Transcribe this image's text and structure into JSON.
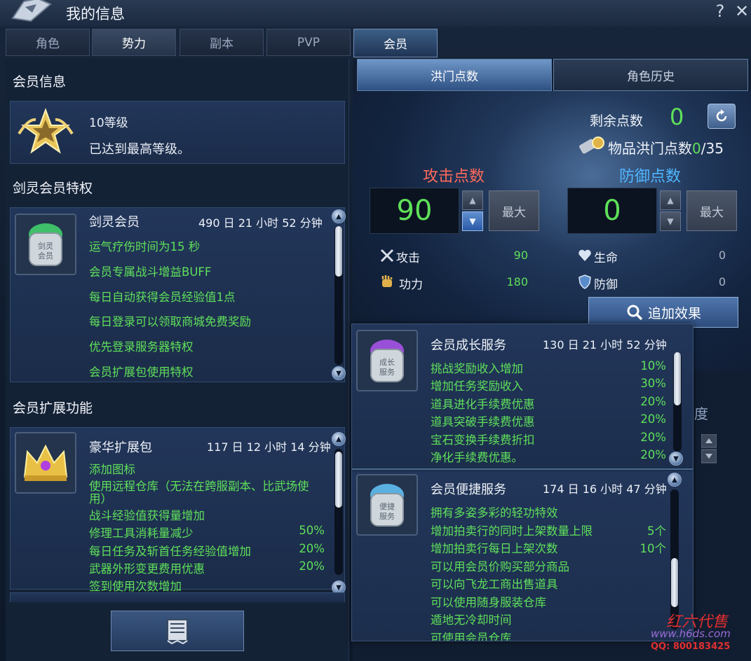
{
  "window": {
    "title": "我的信息",
    "help": "?",
    "close": "✕"
  },
  "tabs": [
    {
      "label": "角色"
    },
    {
      "label": "势力"
    },
    {
      "label": "副本"
    },
    {
      "label": "PVP"
    },
    {
      "label": "会员"
    }
  ],
  "member_info": {
    "heading": "会员信息",
    "grade": "10等级",
    "status": "已达到最高等级。"
  },
  "privileges": {
    "heading": "剑灵会员特权",
    "card": {
      "title": "剑灵会员",
      "time": "490 日 21 小时 52 分钟",
      "lines": [
        "运气疗伤时间为15 秒",
        "会员专属战斗增益BUFF",
        "每日自动获得会员经验值1点",
        "每日登录可以领取商城免费奖励",
        "优先登录服务器特权",
        "会员扩展包使用特权"
      ]
    }
  },
  "extensions": {
    "heading": "会员扩展功能",
    "card": {
      "title": "豪华扩展包",
      "time": "117 日 12 小时 14 分钟",
      "lines": [
        {
          "text": "添加图标",
          "pct": ""
        },
        {
          "text": "使用远程仓库（无法在跨服副本、比武场使",
          "pct": ""
        },
        {
          "text": "用）",
          "pct": ""
        },
        {
          "text": "战斗经验值获得量增加",
          "pct": ""
        },
        {
          "text": "修理工具消耗量减少",
          "pct": "50%"
        },
        {
          "text": "每日任务及斩首任务经验值增加",
          "pct": "20%"
        },
        {
          "text": "武器外形变更费用优惠",
          "pct": "20%"
        },
        {
          "text": "签到使用次数增加",
          "pct": ""
        }
      ]
    }
  },
  "hongmen": {
    "tabs": [
      "洪门点数",
      "角色历史"
    ],
    "remain_label": "剩余点数",
    "remain_value": "0",
    "item_points_label": "物品洪门点数",
    "item_points_current": "0",
    "item_points_max": "/35",
    "attack_title": "攻击点数",
    "defense_title": "防御点数",
    "attack_value": "90",
    "defense_value": "0",
    "max_label": "最大",
    "stats": [
      {
        "label": "攻击",
        "value": "90",
        "icon": "swords-icon"
      },
      {
        "label": "功力",
        "value": "180",
        "icon": "fist-icon"
      },
      {
        "label": "生命",
        "value": "0",
        "icon": "heart-icon"
      },
      {
        "label": "防御",
        "value": "0",
        "icon": "shield-icon"
      }
    ],
    "add_effect": "追加效果"
  },
  "popup": {
    "growth": {
      "title": "会员成长服务",
      "time": "130 日 21 小时 52 分钟",
      "lines": [
        {
          "text": "挑战奖励收入增加",
          "val": "10%"
        },
        {
          "text": "增加任务奖励收入",
          "val": "30%"
        },
        {
          "text": "道具进化手续费优惠",
          "val": "20%"
        },
        {
          "text": "道具突破手续费优惠",
          "val": "20%"
        },
        {
          "text": "宝石变换手续费折扣",
          "val": "20%"
        },
        {
          "text": "净化手续费优惠。",
          "val": "20%"
        }
      ]
    },
    "convenience": {
      "title": "会员便捷服务",
      "time": "174 日 16 小时 47 分钟",
      "lines": [
        {
          "text": "拥有多姿多彩的轻功特效",
          "val": ""
        },
        {
          "text": "增加拍卖行的同时上架数量上限",
          "val": "5个"
        },
        {
          "text": "增加拍卖行每日上架次数",
          "val": "10个"
        },
        {
          "text": "可以用会员价购买部分商品",
          "val": ""
        },
        {
          "text": "可以向飞龙工商出售道具",
          "val": ""
        },
        {
          "text": "可以使用随身服装仓库",
          "val": ""
        },
        {
          "text": "遁地无冷却时间",
          "val": ""
        },
        {
          "text": "可使用会员仓库",
          "val": ""
        }
      ]
    }
  },
  "side_text": "度",
  "watermark": {
    "line1": "红六代售",
    "line2": "www.h6ds.com",
    "line3": "QQ: 800183425"
  },
  "colors": {
    "green": "#5fe05a",
    "attack": "#ff6a5a",
    "defense": "#4fb6ff"
  }
}
